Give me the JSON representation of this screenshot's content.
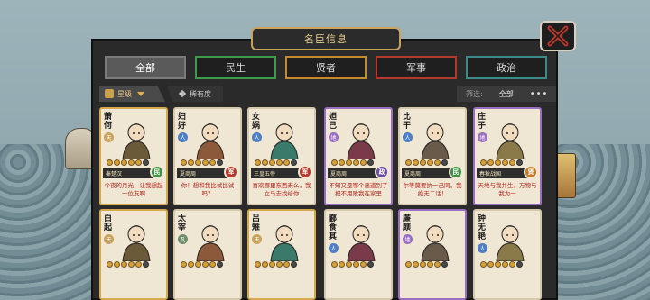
{
  "window": {
    "title": "名臣信息"
  },
  "tabs": [
    {
      "label": "全部",
      "active": true,
      "color": "#7a7a7a"
    },
    {
      "label": "民生",
      "active": false,
      "color": "#3f9a4a"
    },
    {
      "label": "贤者",
      "active": false,
      "color": "#c48a2f"
    },
    {
      "label": "军事",
      "active": false,
      "color": "#b33a2a"
    },
    {
      "label": "政治",
      "active": false,
      "color": "#3a8a8a"
    }
  ],
  "filter": {
    "sort_label": "星级",
    "rarity_label": "稀有度",
    "filter_label": "筛选:",
    "filter_value": "全部",
    "more": "•••"
  },
  "badge_colors": {
    "民": "#3f8f47",
    "军": "#b3392b",
    "政": "#6a4ca0",
    "贤": "#c07a2a"
  },
  "cards_top": [
    {
      "name": "萧何",
      "seal": "天",
      "seal_color": "#c9a35c",
      "frame": "gold",
      "stars_on": 5,
      "era": "秦楚汉",
      "badge": "民",
      "quote": "今夜的月光，让我想起一位友啊"
    },
    {
      "name": "妇好",
      "seal": "人",
      "seal_color": "#4f7fc4",
      "frame": "plain",
      "stars_on": 5,
      "era": "夏商周",
      "badge": "军",
      "quote": "你！想和我比试比试吗？"
    },
    {
      "name": "女娲",
      "seal": "人",
      "seal_color": "#4f7fc4",
      "frame": "plain",
      "stars_on": 5,
      "era": "三皇五帝",
      "badge": "军",
      "quote": "喜欢哪里东西来么，我立马去找给你"
    },
    {
      "name": "妲己",
      "seal": "地",
      "seal_color": "#9a6fc1",
      "frame": "purple",
      "stars_on": 5,
      "era": "夏商周",
      "badge": "政",
      "quote": "不知又是哪个恶道别了把不用败我在家里"
    },
    {
      "name": "比干",
      "seal": "人",
      "seal_color": "#4f7fc4",
      "frame": "plain",
      "stars_on": 5,
      "era": "夏商周",
      "badge": "民",
      "quote": "尔等莫要执一己同，我绝无二话！"
    },
    {
      "name": "庄子",
      "seal": "地",
      "seal_color": "#9a6fc1",
      "frame": "purple",
      "stars_on": 5,
      "era": "春秋战国",
      "badge": "贤",
      "quote": "天地与我并生，万物与我为一"
    }
  ],
  "cards_bottom": [
    {
      "name": "白起",
      "seal": "天",
      "seal_color": "#c9a35c",
      "frame": "gold",
      "stars_on": 5
    },
    {
      "name": "太宰",
      "seal": "凡",
      "seal_color": "#6f8f6a",
      "frame": "plain",
      "stars_on": 5
    },
    {
      "name": "吕雉",
      "seal": "天",
      "seal_color": "#c9a35c",
      "frame": "gold",
      "stars_on": 5
    },
    {
      "name": "郦食其",
      "seal": "人",
      "seal_color": "#4f7fc4",
      "frame": "plain",
      "stars_on": 5
    },
    {
      "name": "廉颇",
      "seal": "地",
      "seal_color": "#9a6fc1",
      "frame": "purple",
      "stars_on": 5
    },
    {
      "name": "钟无艳",
      "seal": "人",
      "seal_color": "#4f7fc4",
      "frame": "plain",
      "stars_on": 5
    }
  ]
}
